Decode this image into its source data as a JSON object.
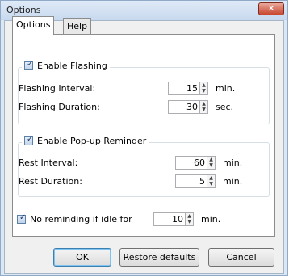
{
  "window": {
    "title": "Options",
    "close_glyph": "✕"
  },
  "tabs": [
    {
      "label": "Options",
      "active": true
    },
    {
      "label": "Help",
      "active": false
    }
  ],
  "flashing": {
    "enable_label": "Enable Flashing",
    "enabled": true,
    "interval_label": "Flashing Interval:",
    "interval_value": "15",
    "interval_unit": "min.",
    "duration_label": "Flashing Duration:",
    "duration_value": "30",
    "duration_unit": "sec."
  },
  "popup": {
    "enable_label": "Enable Pop-up Reminder",
    "enabled": true,
    "rest_interval_label": "Rest Interval:",
    "rest_interval_value": "60",
    "rest_interval_unit": "min.",
    "rest_duration_label": "Rest Duration:",
    "rest_duration_value": "5",
    "rest_duration_unit": "min."
  },
  "idle": {
    "label": "No reminding if idle for",
    "enabled": true,
    "value": "10",
    "unit": "min."
  },
  "check_glyph": "✓",
  "spin_up_glyph": "▲",
  "spin_down_glyph": "▼",
  "buttons": {
    "ok": "OK",
    "restore": "Restore defaults",
    "cancel": "Cancel"
  },
  "colors": {
    "titlebar": "#c8d9ee",
    "close_button": "#c8462f",
    "panel_bg": "#ffffff",
    "default_button_border": "#3c7fb1"
  }
}
